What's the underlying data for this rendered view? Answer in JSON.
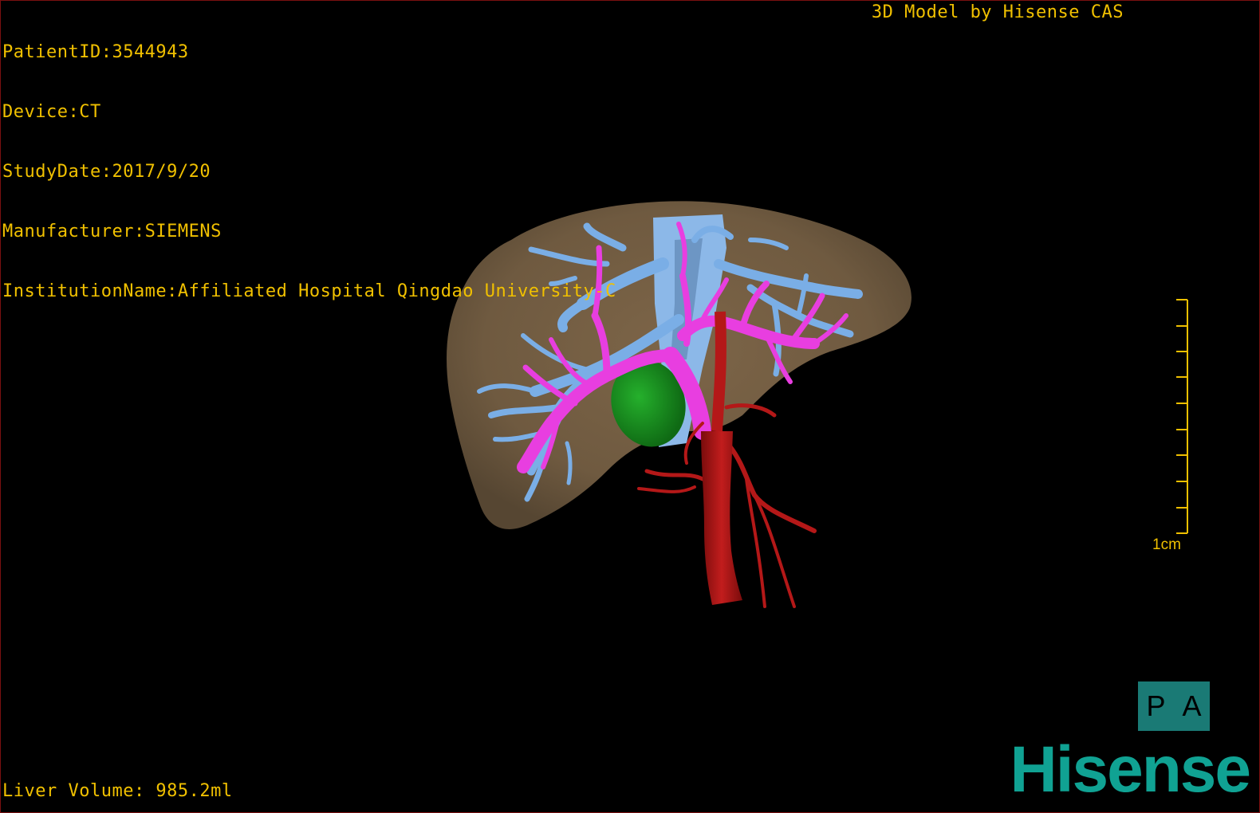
{
  "info": {
    "patient_id": "PatientID:3544943",
    "device": "Device:CT",
    "study_date": "StudyDate:2017/9/20",
    "manufacturer": "Manufacturer:SIEMENS",
    "institution": "InstitutionName:Affiliated Hospital Qingdao University-C"
  },
  "credit": "3D Model by Hisense CAS",
  "liver_volume": "Liver Volume: 985.2ml",
  "scale": {
    "label": "1cm"
  },
  "orientation": {
    "left": "P",
    "right": "A"
  },
  "brand": "Hisense",
  "colors": {
    "liver": "#7a6347",
    "hepatic_veins": "#7aaee6",
    "portal_vein": "#e83ee0",
    "artery": "#b41818",
    "gallbladder": "#1a9a22",
    "overlay_text": "#f0c000",
    "brand": "#10a293"
  }
}
